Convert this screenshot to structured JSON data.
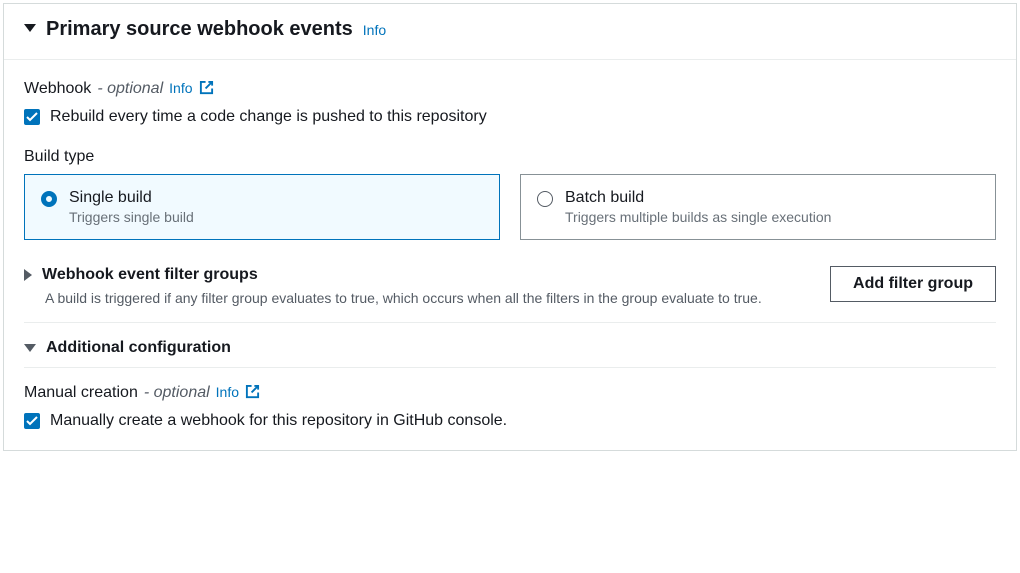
{
  "header": {
    "title": "Primary source webhook events",
    "info": "Info"
  },
  "webhook": {
    "label": "Webhook",
    "optional": "- optional",
    "info": "Info",
    "checkbox_label": "Rebuild every time a code change is pushed to this repository"
  },
  "build_type": {
    "label": "Build type",
    "options": [
      {
        "title": "Single build",
        "desc": "Triggers single build"
      },
      {
        "title": "Batch build",
        "desc": "Triggers multiple builds as single execution"
      }
    ]
  },
  "filter_groups": {
    "title": "Webhook event filter groups",
    "desc": "A build is triggered if any filter group evaluates to true, which occurs when all the filters in the group evaluate to true.",
    "button": "Add filter group"
  },
  "additional": {
    "title": "Additional configuration",
    "manual_label": "Manual creation",
    "manual_optional": "- optional",
    "manual_info": "Info",
    "manual_checkbox_label": "Manually create a webhook for this repository in GitHub console."
  }
}
